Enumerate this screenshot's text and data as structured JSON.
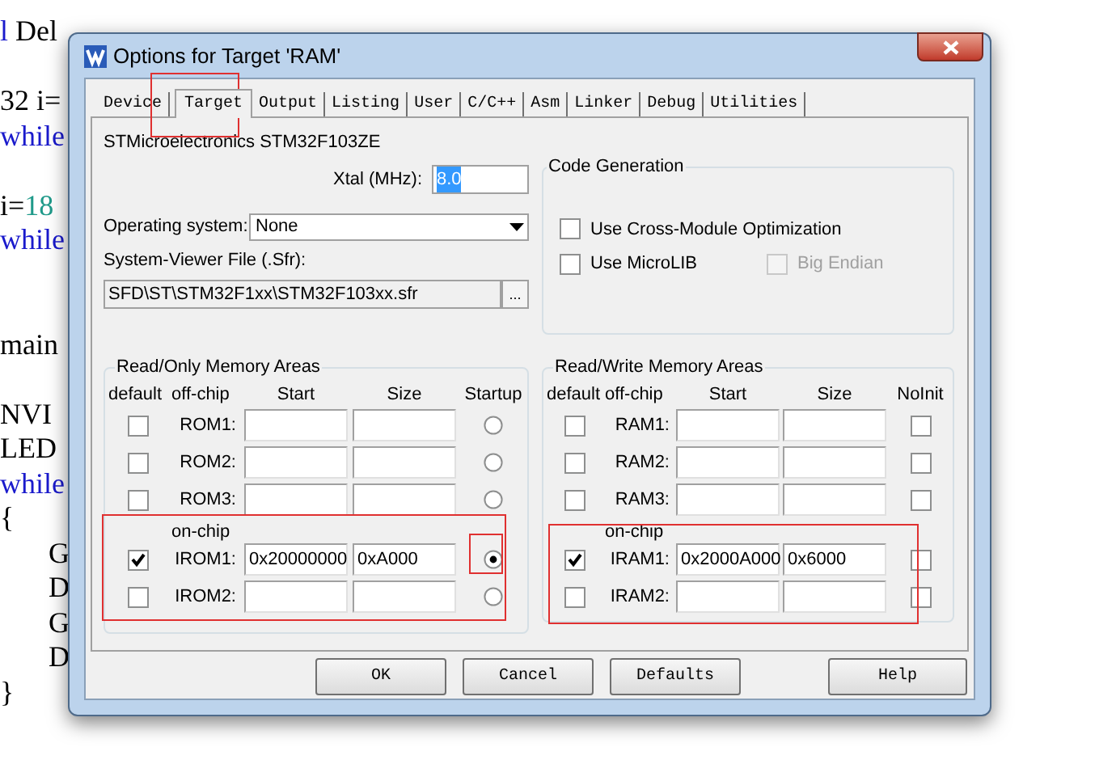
{
  "code_lines": [
    {
      "indented": false,
      "segments": [
        {
          "text": "l",
          "kind": "keyword"
        },
        {
          "text": " Del",
          "kind": "plain"
        }
      ]
    },
    {
      "indented": false,
      "segments": [
        {
          "text": "32 i=",
          "kind": "plain"
        }
      ]
    },
    {
      "indented": false,
      "segments": [
        {
          "text": "while",
          "kind": "keyword"
        }
      ]
    },
    {
      "indented": false,
      "segments": [
        {
          "text": "i=",
          "kind": "plain"
        },
        {
          "text": "18",
          "kind": "number"
        }
      ]
    },
    {
      "indented": false,
      "segments": [
        {
          "text": "while",
          "kind": "keyword"
        }
      ]
    },
    {
      "indented": false,
      "segments": [
        {
          "text": "main",
          "kind": "plain"
        }
      ]
    },
    {
      "indented": false,
      "segments": [
        {
          "text": "NVI",
          "kind": "plain"
        }
      ]
    },
    {
      "indented": false,
      "segments": [
        {
          "text": "LED",
          "kind": "plain"
        }
      ]
    },
    {
      "indented": false,
      "segments": [
        {
          "text": "while",
          "kind": "keyword"
        }
      ]
    },
    {
      "indented": false,
      "segments": [
        {
          "text": "{",
          "kind": "plain"
        }
      ]
    },
    {
      "indented": true,
      "segments": [
        {
          "text": "G",
          "kind": "plain"
        }
      ]
    },
    {
      "indented": true,
      "segments": [
        {
          "text": "D",
          "kind": "plain"
        }
      ]
    },
    {
      "indented": true,
      "segments": [
        {
          "text": "G",
          "kind": "plain"
        }
      ]
    },
    {
      "indented": true,
      "segments": [
        {
          "text": "D",
          "kind": "plain"
        }
      ]
    },
    {
      "indented": false,
      "segments": [
        {
          "text": "}",
          "kind": "plain"
        }
      ]
    }
  ],
  "window": {
    "title": "Options for Target 'RAM'"
  },
  "tabs": [
    {
      "label": "Device",
      "selected": false
    },
    {
      "label": "Target",
      "selected": true
    },
    {
      "label": "Output",
      "selected": false
    },
    {
      "label": "Listing",
      "selected": false
    },
    {
      "label": "User",
      "selected": false
    },
    {
      "label": "C/C++",
      "selected": false
    },
    {
      "label": "Asm",
      "selected": false
    },
    {
      "label": "Linker",
      "selected": false
    },
    {
      "label": "Debug",
      "selected": false
    },
    {
      "label": "Utilities",
      "selected": false
    }
  ],
  "device": "STMicroelectronics STM32F103ZE",
  "xtal": {
    "label": "Xtal (MHz):",
    "value": "8.0",
    "highlighted": true
  },
  "operating_system": {
    "label": "Operating system:",
    "value": "None"
  },
  "system_viewer": {
    "label": "System-Viewer File (.Sfr):",
    "value": "SFD\\ST\\STM32F1xx\\STM32F103xx.sfr",
    "browse": "..."
  },
  "code_generation": {
    "title": "Code Generation",
    "options": [
      {
        "label": "Use Cross-Module Optimization",
        "checked": false,
        "disabled": false
      },
      {
        "label": "Use MicroLIB",
        "checked": false,
        "disabled": false
      },
      {
        "label": "Big Endian",
        "checked": false,
        "disabled": true
      }
    ]
  },
  "rom": {
    "title": "Read/Only Memory Areas",
    "headers": [
      "default",
      "off-chip",
      "Start",
      "Size",
      "Startup"
    ],
    "on_chip_label": "on-chip",
    "rows": [
      {
        "label": "ROM1:",
        "default": false,
        "selected": false
      },
      {
        "label": "ROM2:",
        "default": false,
        "selected": false
      },
      {
        "label": "ROM3:",
        "default": false,
        "selected": false
      },
      {
        "label": "IROM1:",
        "default": true,
        "start": "0x20000000",
        "size": "0xA000",
        "selected": true
      },
      {
        "label": "IROM2:",
        "default": false,
        "selected": false
      }
    ]
  },
  "ram": {
    "title": "Read/Write Memory Areas",
    "headers": [
      "default",
      "off-chip",
      "Start",
      "Size",
      "NoInit"
    ],
    "on_chip_label": "on-chip",
    "rows": [
      {
        "label": "RAM1:",
        "default": false,
        "noinit": false
      },
      {
        "label": "RAM2:",
        "default": false,
        "noinit": false
      },
      {
        "label": "RAM3:",
        "default": false,
        "noinit": false
      },
      {
        "label": "IRAM1:",
        "default": true,
        "start": "0x2000A000",
        "size": "0x6000",
        "noinit": false
      },
      {
        "label": "IRAM2:",
        "default": false,
        "noinit": false
      }
    ]
  },
  "buttons": [
    {
      "label": "OK"
    },
    {
      "label": "Cancel"
    },
    {
      "label": "Defaults"
    },
    {
      "label": "Help"
    }
  ]
}
